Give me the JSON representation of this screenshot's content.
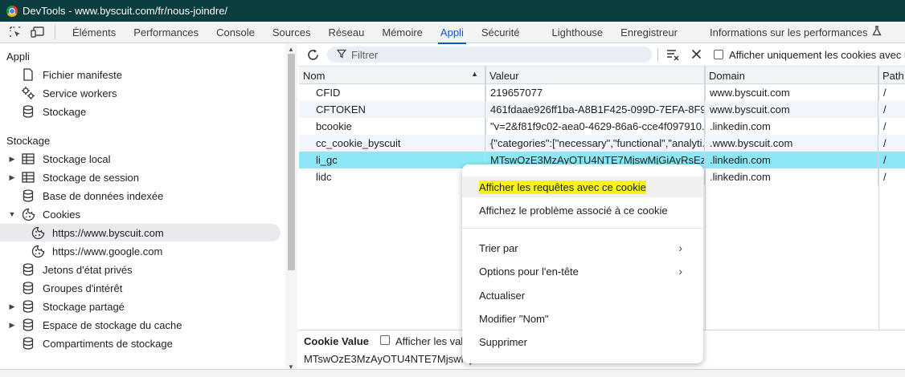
{
  "window": {
    "title": "DevTools - www.byscuit.com/fr/nous-joindre/"
  },
  "tabs": [
    {
      "label": "Éléments"
    },
    {
      "label": "Performances"
    },
    {
      "label": "Console"
    },
    {
      "label": "Sources"
    },
    {
      "label": "Réseau"
    },
    {
      "label": "Mémoire"
    },
    {
      "label": "Appli",
      "active": true
    },
    {
      "label": "Sécurité"
    },
    {
      "label": "Lighthouse"
    },
    {
      "label": "Enregistreur"
    },
    {
      "label": "Informations sur les performances"
    }
  ],
  "sidebar": {
    "section_appli": "Appli",
    "appli_items": [
      {
        "label": "Fichier manifeste",
        "icon": "document-icon"
      },
      {
        "label": "Service workers",
        "icon": "gears-icon"
      },
      {
        "label": "Stockage",
        "icon": "database-icon"
      }
    ],
    "section_stockage": "Stockage",
    "stockage_items": [
      {
        "label": "Stockage local",
        "icon": "table-icon",
        "expandable": true
      },
      {
        "label": "Stockage de session",
        "icon": "table-icon",
        "expandable": true
      },
      {
        "label": "Base de données indexée",
        "icon": "database-icon"
      },
      {
        "label": "Cookies",
        "icon": "cookie-icon",
        "expanded": true
      },
      {
        "label": "https://www.byscuit.com",
        "icon": "cookie-icon",
        "child": true,
        "selected": true
      },
      {
        "label": "https://www.google.com",
        "icon": "cookie-icon",
        "child": true
      },
      {
        "label": "Jetons d'état privés",
        "icon": "database-icon"
      },
      {
        "label": "Groupes d'intérêt",
        "icon": "database-icon"
      },
      {
        "label": "Stockage partagé",
        "icon": "database-icon",
        "expandable": true
      },
      {
        "label": "Espace de stockage du cache",
        "icon": "database-icon",
        "expandable": true
      },
      {
        "label": "Compartiments de stockage",
        "icon": "database-icon"
      }
    ]
  },
  "toolbar": {
    "filter_placeholder": "Filtrer",
    "only_issues_label": "Afficher uniquement les cookies avec un"
  },
  "table": {
    "columns": [
      "Nom",
      "Valeur",
      "Domain",
      "Path"
    ],
    "rows": [
      {
        "name": "CFID",
        "value": "219657077",
        "domain": "www.byscuit.com",
        "path": "/"
      },
      {
        "name": "CFTOKEN",
        "value": "461fdaae926ff1ba-A8B1F425-099D-7EFA-8F9...",
        "domain": "www.byscuit.com",
        "path": "/"
      },
      {
        "name": "bcookie",
        "value": "\"v=2&f81f9c02-aea0-4629-86a6-cce4f097910...",
        "domain": ".linkedin.com",
        "path": "/"
      },
      {
        "name": "cc_cookie_byscuit",
        "value": "{\"categories\":[\"necessary\",\"functional\",\"analyti...",
        "domain": ".www.byscuit.com",
        "path": "/"
      },
      {
        "name": "li_gc",
        "value": "MTswOzE3MzAyOTU4NTE7MjswMjGiAyRsEzf...",
        "domain": ".linkedin.com",
        "path": "/",
        "selected": true
      },
      {
        "name": "lidc",
        "value": "",
        "domain": ".linkedin.com",
        "path": "/"
      }
    ]
  },
  "value_pane": {
    "title": "Cookie Value",
    "decoded_label": "Afficher les vale",
    "value": "MTswOzE3MzAyOTU4NTE7MjswMjG"
  },
  "context_menu": {
    "items": [
      {
        "label": "Afficher les requêtes avec ce cookie",
        "highlighted": true
      },
      {
        "label": "Affichez le problème associé à ce cookie"
      },
      {
        "label": "Trier par",
        "submenu": true
      },
      {
        "label": "Options pour l'en-tête",
        "submenu": true
      },
      {
        "label": "Actualiser"
      },
      {
        "label": "Modifier \"Nom\""
      },
      {
        "label": "Supprimer"
      }
    ]
  },
  "colors": {
    "titlebar_bg": "#0b3d3f",
    "accent": "#0b57d0",
    "selected_row": "#8ee7f7",
    "highlight": "#f7f320"
  }
}
